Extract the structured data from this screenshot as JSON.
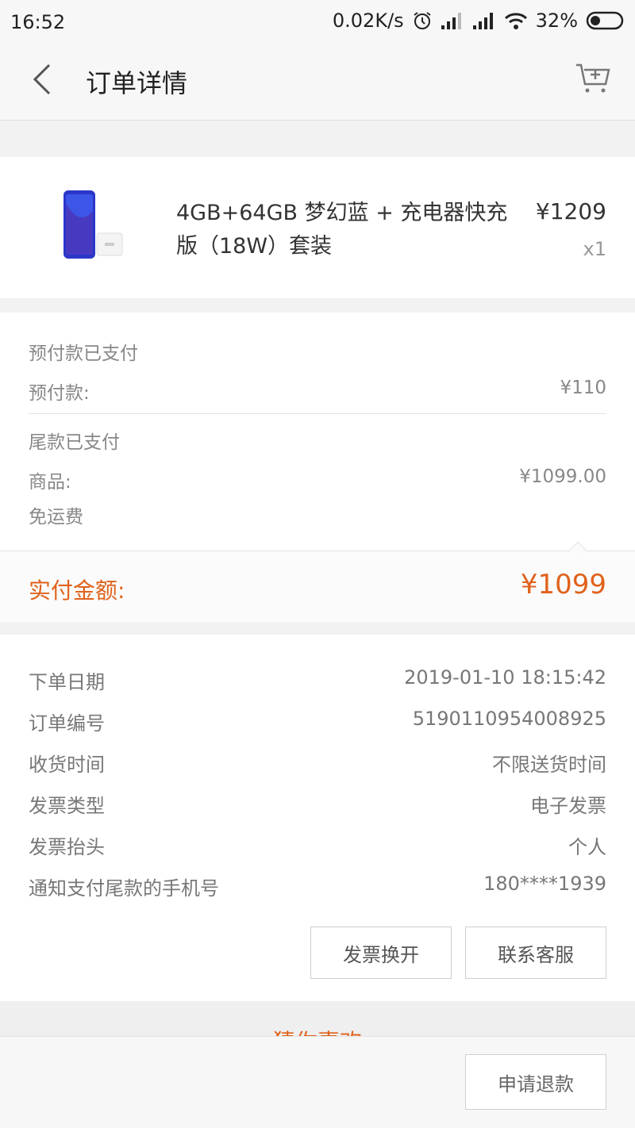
{
  "status_bar": {
    "time": "16:52",
    "net_speed": "0.02K/s",
    "battery": "32%",
    "icons": [
      "alarm-icon",
      "signal-icon",
      "signal-icon",
      "wifi-icon",
      "battery-icon"
    ]
  },
  "header": {
    "title": "订单详情",
    "back_icon": "chevron-left-icon",
    "cart_icon": "cart-add-icon"
  },
  "product": {
    "name": "4GB+64GB 梦幻蓝 + 充电器快充版（18W）套装",
    "price": "¥1209",
    "quantity": "x1"
  },
  "payment": {
    "deposit_status": "预付款已支付",
    "deposit_label": "预付款:",
    "deposit_value": "¥110",
    "balance_status": "尾款已支付",
    "goods_label": "商品:",
    "goods_value": "¥1099.00",
    "shipping": "免运费",
    "total_label": "实付金额:",
    "total_value": "¥1099"
  },
  "order_info": [
    {
      "label": "下单日期",
      "value": "2019-01-10 18:15:42"
    },
    {
      "label": "订单编号",
      "value": "5190110954008925"
    },
    {
      "label": "收货时间",
      "value": "不限送货时间"
    },
    {
      "label": "发票类型",
      "value": "电子发票"
    },
    {
      "label": "发票抬头",
      "value": "个人"
    },
    {
      "label": "通知支付尾款的手机号",
      "value": "180****1939"
    }
  ],
  "actions": {
    "invoice_reissue": "发票换开",
    "contact_service": "联系客服",
    "refund": "申请退款"
  },
  "recommend": {
    "title": "猜你喜欢"
  },
  "colors": {
    "accent": "#e0621b",
    "text_secondary": "#888888"
  }
}
